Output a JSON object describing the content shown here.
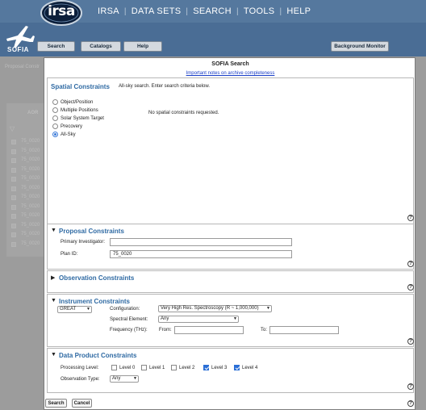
{
  "header": {
    "brand": "irsa",
    "mission": "SOFIA",
    "nav": [
      "IRSA",
      "DATA SETS",
      "SEARCH",
      "TOOLS",
      "HELP"
    ]
  },
  "toolbar": {
    "search": "Search",
    "catalogs": "Catalogs",
    "help": "Help",
    "background_monitor": "Background Monitor"
  },
  "background": {
    "proposal_label": "Proposal Constr",
    "aor_header": "AOR",
    "rows": [
      "75_0020",
      "75_0020",
      "75_0020",
      "75_0020",
      "75_0020",
      "75_0020",
      "75_0020",
      "75_0020",
      "75_0020",
      "75_0020",
      "75_0020",
      "75_0020"
    ]
  },
  "dialog": {
    "title": "SOFIA Search",
    "notes_link": "Important notes on archive completeness",
    "spatial": {
      "title": "Spatial Constraints",
      "description": "All-sky search. Enter search criteria below.",
      "options": [
        "Object/Position",
        "Multiple Positions",
        "Solar System Target",
        "Precovery",
        "All-Sky"
      ],
      "selected": "All-Sky",
      "message": "No spatial constraints requested."
    },
    "proposal": {
      "title": "Proposal Constraints",
      "pi_label": "Primary Investigator:",
      "pi_value": "",
      "plan_label": "Plan ID:",
      "plan_value": "75_0020"
    },
    "observation": {
      "title": "Observation Constraints"
    },
    "instrument": {
      "title": "Instrument Constraints",
      "instrument": "GREAT",
      "config_label": "Configuration:",
      "config_value": "Very High Res. Spectroscopy (R ~ 1,000,000)",
      "spectral_label": "Spectral Element:",
      "spectral_value": "Any",
      "freq_label": "Frequency (THz):",
      "from_label": "From:",
      "from_value": "",
      "to_label": "To:",
      "to_value": ""
    },
    "data_product": {
      "title": "Data Product Constraints",
      "level_label": "Processing Level:",
      "levels": [
        {
          "label": "Level 0",
          "checked": false
        },
        {
          "label": "Level 1",
          "checked": false
        },
        {
          "label": "Level 2",
          "checked": false
        },
        {
          "label": "Level 3",
          "checked": true
        },
        {
          "label": "Level 4",
          "checked": true
        }
      ],
      "obs_type_label": "Observation Type:",
      "obs_type_value": "Any"
    },
    "buttons": {
      "search": "Search",
      "cancel": "Cancel"
    },
    "help_glyph": "?"
  },
  "colors": {
    "header_bg": "#55789e",
    "section_title": "#2f6aa3",
    "link": "#1a3fc8",
    "checkbox_on": "#2b6fd6"
  }
}
